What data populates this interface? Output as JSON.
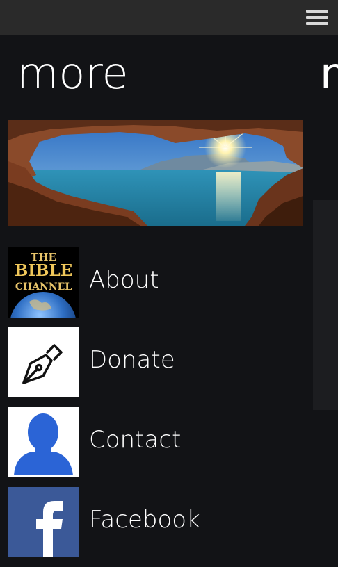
{
  "header": {
    "menu_icon": "hamburger-menu-icon"
  },
  "pivot": {
    "title": "more",
    "next_peek": "n"
  },
  "banner": {
    "image": "sea-cave-sunset-photo"
  },
  "list": {
    "items": [
      {
        "label": "About",
        "icon": "bible-channel-logo",
        "logo_text": {
          "line1": "THE",
          "line2": "BIBLE",
          "line3": "CHANNEL"
        }
      },
      {
        "label": "Donate",
        "icon": "fountain-pen-icon"
      },
      {
        "label": "Contact",
        "icon": "person-silhouette-icon"
      },
      {
        "label": "Facebook",
        "icon": "facebook-icon"
      }
    ]
  },
  "colors": {
    "background": "#121316",
    "top_bar": "#2a2a2a",
    "contact_blue": "#2b64d6",
    "facebook_blue": "#3b5998"
  }
}
